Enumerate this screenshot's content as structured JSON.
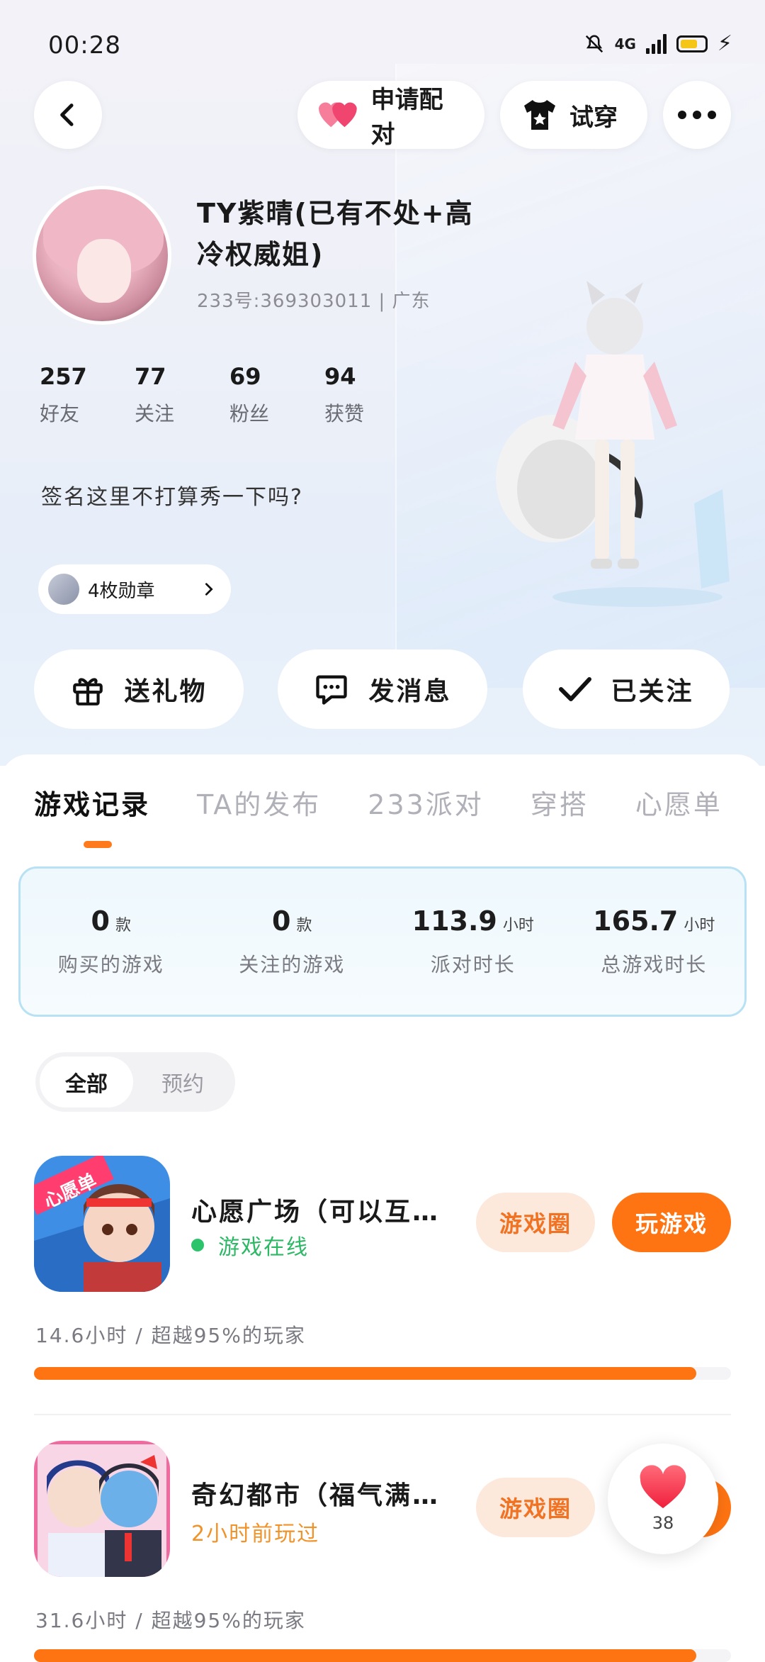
{
  "status_bar": {
    "time": "00:28",
    "network": "4G"
  },
  "top_actions": {
    "match_label": "申请配对",
    "tryon_label": "试穿"
  },
  "profile": {
    "nickname": "TY紫晴(已有不处+高冷权威姐)",
    "uid_region": "233号:369303011 | 广东",
    "stats": [
      {
        "value": "257",
        "label": "好友"
      },
      {
        "value": "77",
        "label": "关注"
      },
      {
        "value": "69",
        "label": "粉丝"
      },
      {
        "value": "94",
        "label": "获赞"
      }
    ],
    "signature": "签名这里不打算秀一下吗?",
    "badges_label": "4枚勋章"
  },
  "actions": {
    "gift_label": "送礼物",
    "message_label": "发消息",
    "follow_label": "已关注"
  },
  "tabs": [
    "游戏记录",
    "TA的发布",
    "233派对",
    "穿搭",
    "心愿单"
  ],
  "summary": [
    {
      "value": "0",
      "unit": "款",
      "label": "购买的游戏"
    },
    {
      "value": "0",
      "unit": "款",
      "label": "关注的游戏"
    },
    {
      "value": "113.9",
      "unit": "小时",
      "label": "派对时长"
    },
    {
      "value": "165.7",
      "unit": "小时",
      "label": "总游戏时长"
    }
  ],
  "filter": {
    "all_label": "全部",
    "reserve_label": "预约"
  },
  "games": [
    {
      "title": "心愿广场（可以互…",
      "status": "游戏在线",
      "circle_label": "游戏圈",
      "play_label": "玩游戏",
      "play_time": "14.6小时 / 超越95%的玩家",
      "progress_percent": 95,
      "icon_badge": "心愿单"
    },
    {
      "title": "奇幻都市（福气满…",
      "status": "2小时前玩过",
      "circle_label": "游戏圈",
      "play_time": "31.6小时 / 超越95%的玩家",
      "progress_percent": 95
    }
  ],
  "like_float": {
    "count": "38"
  },
  "colors": {
    "accent": "#ff7412",
    "online": "#2cc46a",
    "card_border": "#b9e1f4"
  }
}
